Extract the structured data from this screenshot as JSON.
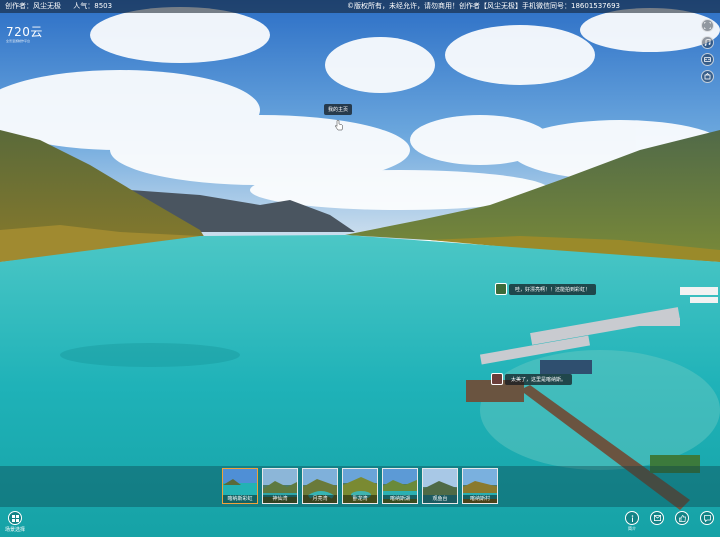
{
  "topbar": {
    "creator": "创作者：风尘无极",
    "popularity": "人气：8503",
    "notice": "©版权所有，未经允许，请勿商用！创作者【风尘无极】手机微信同号：18601537693"
  },
  "logo": {
    "text": "720云",
    "subtitle": "全景漫游制作平台"
  },
  "tooltip": {
    "text": "我的主页"
  },
  "hotspots": [
    {
      "text": "哇，好漂亮啊！！还能拍到彩虹！"
    },
    {
      "text": "太美了，这里是喀纳斯。"
    }
  ],
  "thumbnails": [
    {
      "label": "喀纳斯彩虹",
      "active": true
    },
    {
      "label": "神仙湾",
      "active": false
    },
    {
      "label": "月亮湾",
      "active": false
    },
    {
      "label": "卧龙湾",
      "active": false
    },
    {
      "label": "喀纳斯湖",
      "active": false
    },
    {
      "label": "观鱼台",
      "active": false
    },
    {
      "label": "喀纳斯村",
      "active": false
    }
  ],
  "bottom_left": {
    "label": "场景选择"
  },
  "bottom_right": [
    {
      "icon": "info-icon",
      "label": "简介"
    },
    {
      "icon": "message-icon",
      "label": ""
    },
    {
      "icon": "like-icon",
      "label": ""
    },
    {
      "icon": "comment-icon",
      "label": ""
    }
  ],
  "right_icons": [
    "fullscreen-icon",
    "music-icon",
    "vr-icon",
    "gyro-icon"
  ],
  "colors": {
    "water": "#1fb2b8",
    "sky": "#3a86d6",
    "active_thumb_border": "#f2a23a"
  }
}
